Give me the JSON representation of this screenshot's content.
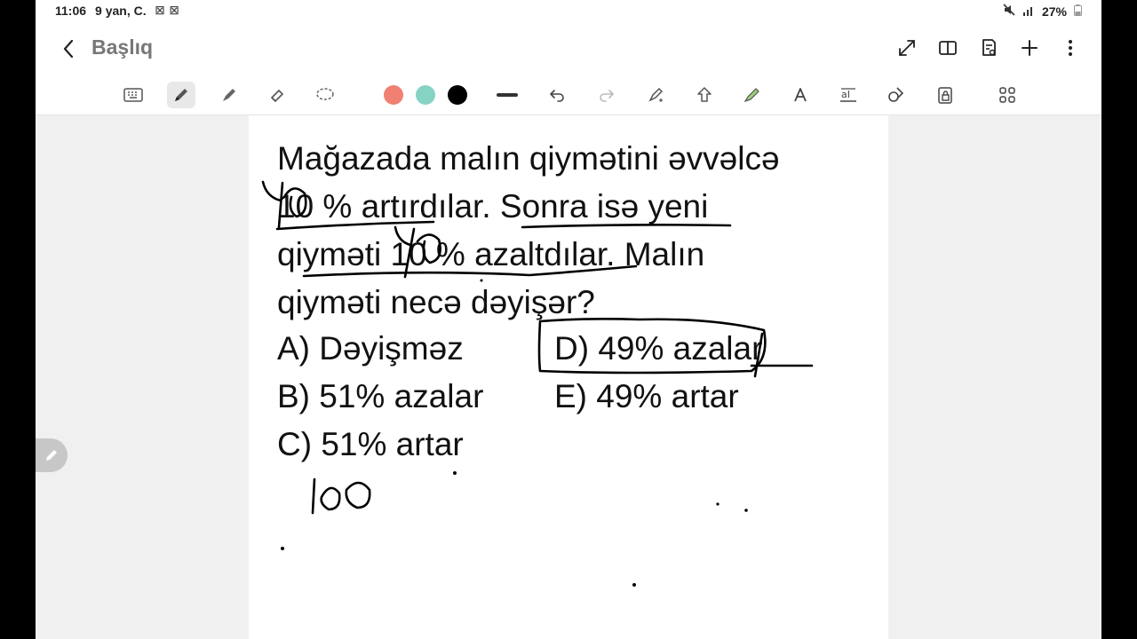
{
  "status_bar": {
    "time": "11:06",
    "date": "9 yan, C.",
    "extra_icons": "☒ ☒",
    "battery": "27%"
  },
  "title_bar": {
    "title": "Başlıq"
  },
  "toolbar": {
    "colors": [
      "#f08072",
      "#86d3c4",
      "#000000"
    ]
  },
  "note": {
    "question_line1": "Mağazada malın qiymətini əvvəlcə",
    "question_line2": "10 % artırdılar. Sonra isə yeni",
    "question_line3": "qiyməti 10 % azaltdılar. Malın",
    "question_line4": "qiyməti necə dəyişər?",
    "options": {
      "a": "A) Dəyişməz",
      "b": "B) 51% azalar",
      "c": "C) 51% artar",
      "d": "D) 49% azalar",
      "e": "E) 49% artar"
    }
  }
}
